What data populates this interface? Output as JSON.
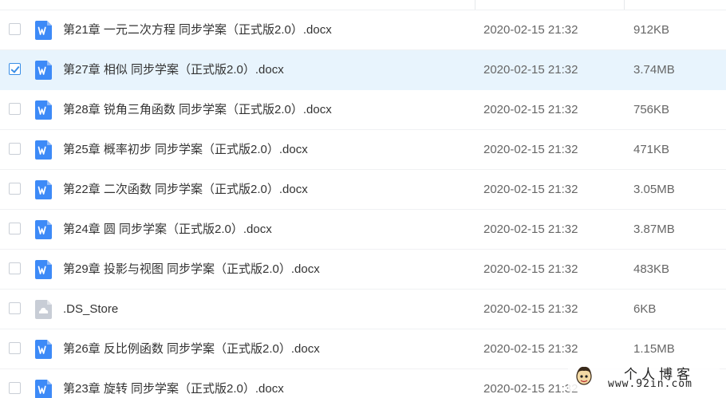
{
  "colors": {
    "selected_row_bg": "#e8f4fd",
    "checkbox_accent": "#3a8ee6",
    "doc_icon": "#3d8af7",
    "generic_icon": "#c8cdd6"
  },
  "files": [
    {
      "name": "第21章 一元二次方程 同步学案（正式版2.0）.docx",
      "date": "2020-02-15 21:32",
      "size": "912KB",
      "icon": "word-doc-icon",
      "selected": false
    },
    {
      "name": "第27章 相似 同步学案（正式版2.0）.docx",
      "date": "2020-02-15 21:32",
      "size": "3.74MB",
      "icon": "word-doc-icon",
      "selected": true
    },
    {
      "name": "第28章 锐角三角函数 同步学案（正式版2.0）.docx",
      "date": "2020-02-15 21:32",
      "size": "756KB",
      "icon": "word-doc-icon",
      "selected": false
    },
    {
      "name": "第25章 概率初步 同步学案（正式版2.0）.docx",
      "date": "2020-02-15 21:32",
      "size": "471KB",
      "icon": "word-doc-icon",
      "selected": false
    },
    {
      "name": "第22章 二次函数 同步学案（正式版2.0）.docx",
      "date": "2020-02-15 21:32",
      "size": "3.05MB",
      "icon": "word-doc-icon",
      "selected": false
    },
    {
      "name": "第24章 圆 同步学案（正式版2.0）.docx",
      "date": "2020-02-15 21:32",
      "size": "3.87MB",
      "icon": "word-doc-icon",
      "selected": false
    },
    {
      "name": "第29章 投影与视图 同步学案（正式版2.0）.docx",
      "date": "2020-02-15 21:32",
      "size": "483KB",
      "icon": "word-doc-icon",
      "selected": false
    },
    {
      "name": ".DS_Store",
      "date": "2020-02-15 21:32",
      "size": "6KB",
      "icon": "generic-file-icon",
      "selected": false
    },
    {
      "name": "第26章 反比例函数 同步学案（正式版2.0）.docx",
      "date": "2020-02-15 21:32",
      "size": "1.15MB",
      "icon": "word-doc-icon",
      "selected": false
    },
    {
      "name": "第23章 旋转 同步学案（正式版2.0）.docx",
      "date": "2020-02-15 21:32",
      "size": "",
      "icon": "word-doc-icon",
      "selected": false
    }
  ],
  "watermark": {
    "title": "个人博客",
    "url": "www.92in.com"
  }
}
